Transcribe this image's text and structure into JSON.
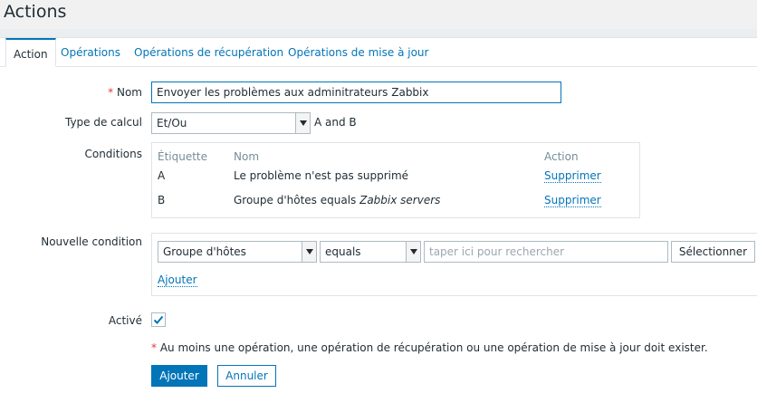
{
  "header": {
    "title": "Actions"
  },
  "tabs": [
    {
      "label": "Action"
    },
    {
      "label": "Opérations"
    },
    {
      "label": "Opérations de récupération"
    },
    {
      "label": "Opérations de mise à jour"
    }
  ],
  "form": {
    "name": {
      "required_mark": "*",
      "label": "Nom",
      "value": "Envoyer les problèmes aux adminitrateurs Zabbix"
    },
    "calc": {
      "label": "Type de calcul",
      "selected": "Et/Ou",
      "formula": "A and B"
    },
    "conditions": {
      "label": "Conditions",
      "headers": {
        "tag": "Étiquette",
        "name": "Nom",
        "action": "Action"
      },
      "rows": [
        {
          "tag": "A",
          "name": "Le problème n'est pas supprimé",
          "name_italic": "",
          "action": "Supprimer"
        },
        {
          "tag": "B",
          "name": "Groupe d'hôtes equals ",
          "name_italic": "Zabbix servers",
          "action": "Supprimer"
        }
      ]
    },
    "new_condition": {
      "label": "Nouvelle condition",
      "type_selected": "Groupe d'hôtes",
      "operator_selected": "equals",
      "search_placeholder": "taper ici pour rechercher",
      "select_button": "Sélectionner",
      "add_link": "Ajouter"
    },
    "enabled": {
      "label": "Activé",
      "checked": true
    },
    "warning": {
      "mark": "*",
      "text": "Au moins une opération, une opération de récupération ou une opération de mise à jour doit exister."
    },
    "buttons": {
      "add": "Ajouter",
      "cancel": "Annuler"
    }
  },
  "colors": {
    "accent": "#0275b8",
    "required": "#e33734",
    "background": "#ebeef0"
  }
}
